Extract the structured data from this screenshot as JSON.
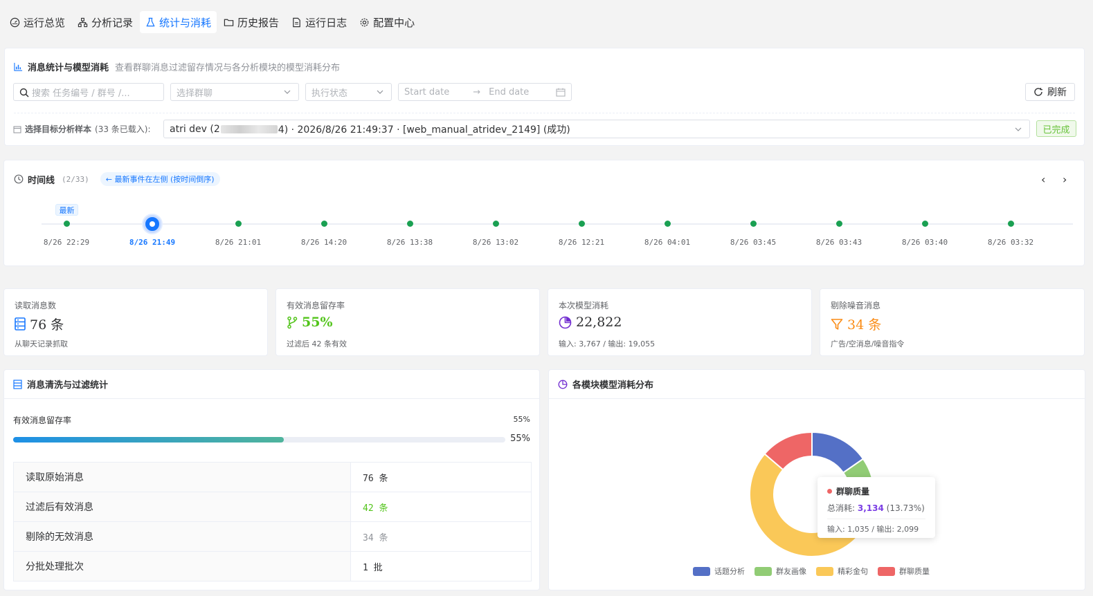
{
  "tabs": [
    {
      "label": "运行总览",
      "icon": "dashboard-icon"
    },
    {
      "label": "分析记录",
      "icon": "hierarchy-icon"
    },
    {
      "label": "统计与消耗",
      "icon": "flask-icon"
    },
    {
      "label": "历史报告",
      "icon": "folder-icon"
    },
    {
      "label": "运行日志",
      "icon": "file-icon"
    },
    {
      "label": "配置中心",
      "icon": "gear-icon"
    }
  ],
  "header": {
    "title": "消息统计与模型消耗",
    "description": "查看群聊消息过滤留存情况与各分析模块的模型消耗分布",
    "search_placeholder": "搜索 任务编号 / 群号 /...",
    "group_placeholder": "选择群聊",
    "status_placeholder": "执行状态",
    "start_date": "Start date",
    "end_date": "End date",
    "refresh_label": "刷新",
    "sample_label": "选择目标分析样本",
    "sample_loaded": "(33 条已载入):",
    "sample_value_prefix": "atri dev (2",
    "sample_value_suffix": "4) · 2026/8/26 21:49:37 · [web_manual_atridev_2149] (成功)",
    "sample_status": "已完成"
  },
  "timeline": {
    "title": "时间线",
    "count": "(2/33)",
    "hint": "← 最新事件在左侧 (按时间倒序)",
    "latest_badge": "最新",
    "events": [
      "8/26 22:29",
      "8/26 21:49",
      "8/26 21:01",
      "8/26 14:20",
      "8/26 13:38",
      "8/26 13:02",
      "8/26 12:21",
      "8/26 04:01",
      "8/26 03:45",
      "8/26 03:43",
      "8/26 03:40",
      "8/26 03:32"
    ],
    "active_index": 1
  },
  "stats": [
    {
      "label": "读取消息数",
      "value": "76 条",
      "sub": "从聊天记录抓取",
      "icon": "database-icon",
      "color": "#1677ff"
    },
    {
      "label": "有效消息留存率",
      "value": "55%",
      "sub": "过滤后 42 条有效",
      "icon": "branch-icon",
      "color": "#52c41a"
    },
    {
      "label": "本次模型消耗",
      "value": "22,822",
      "sub": "输入: 3,767 / 输出: 19,055",
      "icon": "pie-chart-icon",
      "color": "#722ed1"
    },
    {
      "label": "剔除噪音消息",
      "value": "34 条",
      "sub": "广告/空消息/噪音指令",
      "icon": "filter-icon",
      "color": "#fa8c16"
    }
  ],
  "filter_panel": {
    "title": "消息清洗与过滤统计",
    "rate_label": "有效消息留存率",
    "rate_value": "55%",
    "rate_fraction": 0.55,
    "rows": [
      {
        "key": "读取原始消息",
        "value": "76 条",
        "color": "#303133"
      },
      {
        "key": "过滤后有效消息",
        "value": "42 条",
        "color": "#52c41a"
      },
      {
        "key": "剔除的无效消息",
        "value": "34 条",
        "color": "#909399"
      },
      {
        "key": "分批处理批次",
        "value": "1 批",
        "color": "#303133"
      }
    ]
  },
  "consumption_panel": {
    "title": "各模块模型消耗分布",
    "legend": [
      {
        "name": "话题分析",
        "color": "#5470c6"
      },
      {
        "name": "群友画像",
        "color": "#91cc75"
      },
      {
        "name": "精彩金句",
        "color": "#fac858"
      },
      {
        "name": "群聊质量",
        "color": "#ee6666"
      }
    ],
    "tooltip": {
      "name": "群聊质量",
      "total_label": "总消耗:",
      "total_value": "3,134",
      "percent": "(13.73%)",
      "io": "输入: 1,035 / 输出: 2,099"
    }
  },
  "chart_data": {
    "type": "pie",
    "donut": true,
    "categories": [
      "话题分析",
      "群友画像",
      "精彩金句",
      "群聊质量"
    ],
    "values": [
      3500,
      1600,
      14588,
      3134
    ],
    "colors": [
      "#5470c6",
      "#91cc75",
      "#fac858",
      "#ee6666"
    ],
    "legend_position": "bottom"
  }
}
